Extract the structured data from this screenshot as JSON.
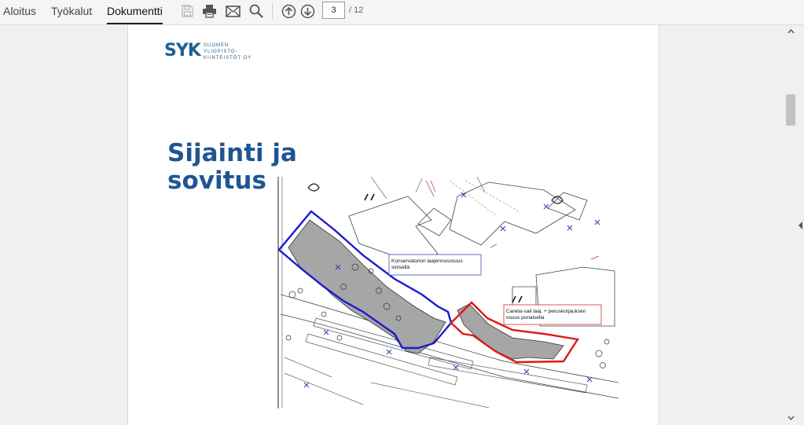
{
  "tabs": [
    {
      "label": "Aloitus"
    },
    {
      "label": "Työkalut"
    },
    {
      "label": "Dokumentti",
      "active": true
    }
  ],
  "toolbar": {
    "icons": [
      "save-icon",
      "print-icon",
      "email-icon",
      "search-icon",
      "page-up-icon",
      "page-down-icon"
    ],
    "current_page": "3",
    "total_pages": "/ 12"
  },
  "page": {
    "logo": {
      "mark": "SYK",
      "lines": [
        "Suomen",
        "Yliopisto-",
        "Kiinteistöt Oy"
      ]
    },
    "title_line1": "Sijainti ja",
    "title_line2": "sovitus",
    "map": {
      "label_blue": [
        "Konservatorion laajennusosuus",
        "sinisellä"
      ],
      "label_red": [
        "Carelia-sali laaj. + peruskorjauksen",
        "osuus punaisella"
      ]
    }
  },
  "colors": {
    "title": "#1f5593",
    "logo": "#1f5f8f",
    "blue_outline": "#1a1ad0",
    "red_outline": "#e01818",
    "building_fill": "#a6a6a6"
  }
}
